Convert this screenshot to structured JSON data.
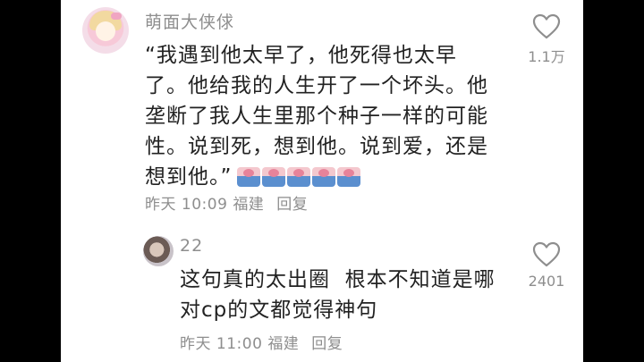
{
  "comments": [
    {
      "username": "萌面大侠俅",
      "text": "“我遇到他太早了，他死得也太早\n了。他给我的人生开了一个坏头。他\n垄断了我人生里那个种子一样的可能\n性。说到死，想到他。说到爱，还是\n想到他。”",
      "emoji_count": 5,
      "time": "昨天 10:09",
      "location": "福建",
      "reply_label": "回复",
      "likes": "1.1万"
    },
    {
      "username": "22",
      "text": "这句真的太出圈  根本不知道是哪\n对cp的文都觉得神句",
      "time": "昨天 11:00",
      "location": "福建",
      "reply_label": "回复",
      "likes": "2401"
    }
  ],
  "icons": {
    "like": "heart-outline-icon",
    "emoji": "bear-emoji-icon"
  },
  "colors": {
    "background": "#ffffff",
    "secondary_text": "#8e8e8e",
    "body_text": "#222222"
  }
}
